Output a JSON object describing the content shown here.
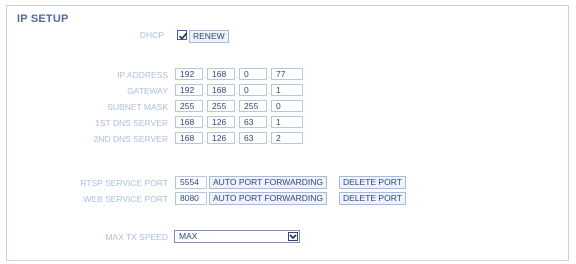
{
  "title": "IP SETUP",
  "dhcp": {
    "label": "DHCP",
    "checked": true,
    "renew_label": "RENEW"
  },
  "network": [
    {
      "label": "IP ADDRESS",
      "octets": [
        "192",
        "168",
        "0",
        "77"
      ]
    },
    {
      "label": "GATEWAY",
      "octets": [
        "192",
        "168",
        "0",
        "1"
      ]
    },
    {
      "label": "SUBNET MASK",
      "octets": [
        "255",
        "255",
        "255",
        "0"
      ]
    },
    {
      "label": "1ST DNS SERVER",
      "octets": [
        "168",
        "126",
        "63",
        "1"
      ]
    },
    {
      "label": "2ND DNS SERVER",
      "octets": [
        "168",
        "126",
        "63",
        "2"
      ]
    }
  ],
  "separator": ".",
  "ports": [
    {
      "label": "RTSP SERVICE PORT",
      "value": "5554",
      "forward_label": "AUTO PORT FORWARDING",
      "delete_label": "DELETE PORT"
    },
    {
      "label": "WEB SERVICE PORT",
      "value": "8080",
      "forward_label": "AUTO PORT FORWARDING",
      "delete_label": "DELETE PORT"
    }
  ],
  "tx_speed": {
    "label": "MAX TX SPEED",
    "value": "MAX"
  },
  "colors": {
    "title": "#4c6ba8",
    "label": "#aebedb",
    "border": "#c8d2e2"
  },
  "icons": {
    "checkbox": "check-icon",
    "dropdown": "chevron-down-icon"
  }
}
